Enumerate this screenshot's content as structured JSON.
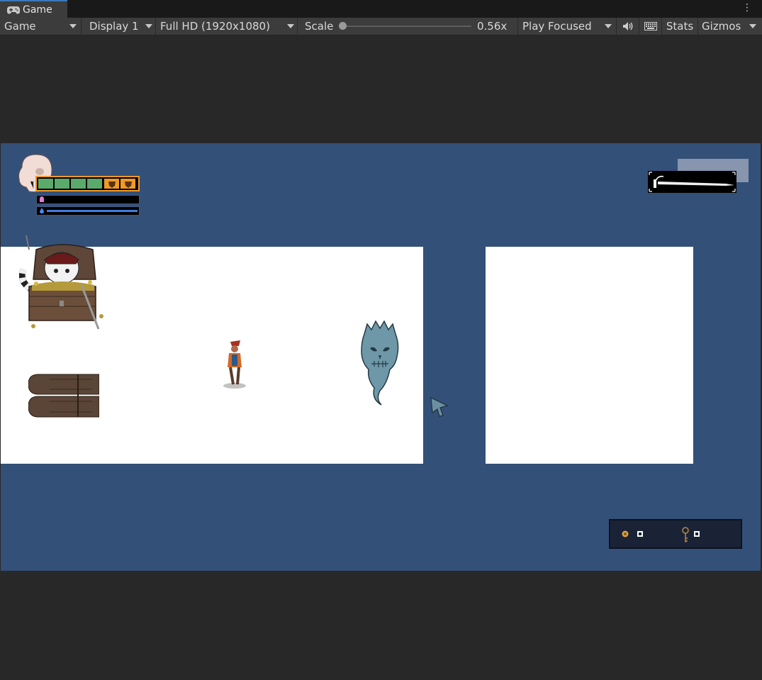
{
  "window": {
    "tab_label": "Game",
    "tab_icon": "gamepad-icon",
    "menu_icon": "kebab-icon"
  },
  "toolbar": {
    "view_mode": "Game",
    "display": "Display 1",
    "resolution": "Full HD (1920x1080)",
    "scale_label": "Scale",
    "scale_value": "0.56x",
    "scale_level": 0.0,
    "play_mode": "Play Focused",
    "mute_icon": "speaker-icon",
    "keyboard_icon": "keyboard-icon",
    "stats": "Stats",
    "gizmos": "Gizmos"
  },
  "hud": {
    "portrait_icon": "skull-icon",
    "health_segments": [
      "full",
      "full",
      "full",
      "full",
      "shield",
      "shield"
    ],
    "mana_icon": "pink-potion-icon",
    "stamina_icon": "blue-drop-icon",
    "stamina_level": 1.0,
    "weapon_icon": "sword-icon"
  },
  "inventory": {
    "slot1_icon": "coin-icon",
    "slot2_icon": "key-icon"
  },
  "colors": {
    "editor_bg": "#282828",
    "toolbar_bg": "#3c3c3c",
    "game_bg": "#335078",
    "health": "#5aaa6c",
    "shield": "#f09a28",
    "stamina": "#3f7be0"
  },
  "scene_objects": [
    "treasure-chest-sprite",
    "pirate-player-sprite",
    "ghost-skull-sprite",
    "wooden-door-sprite",
    "cursor-arrow-sprite"
  ]
}
